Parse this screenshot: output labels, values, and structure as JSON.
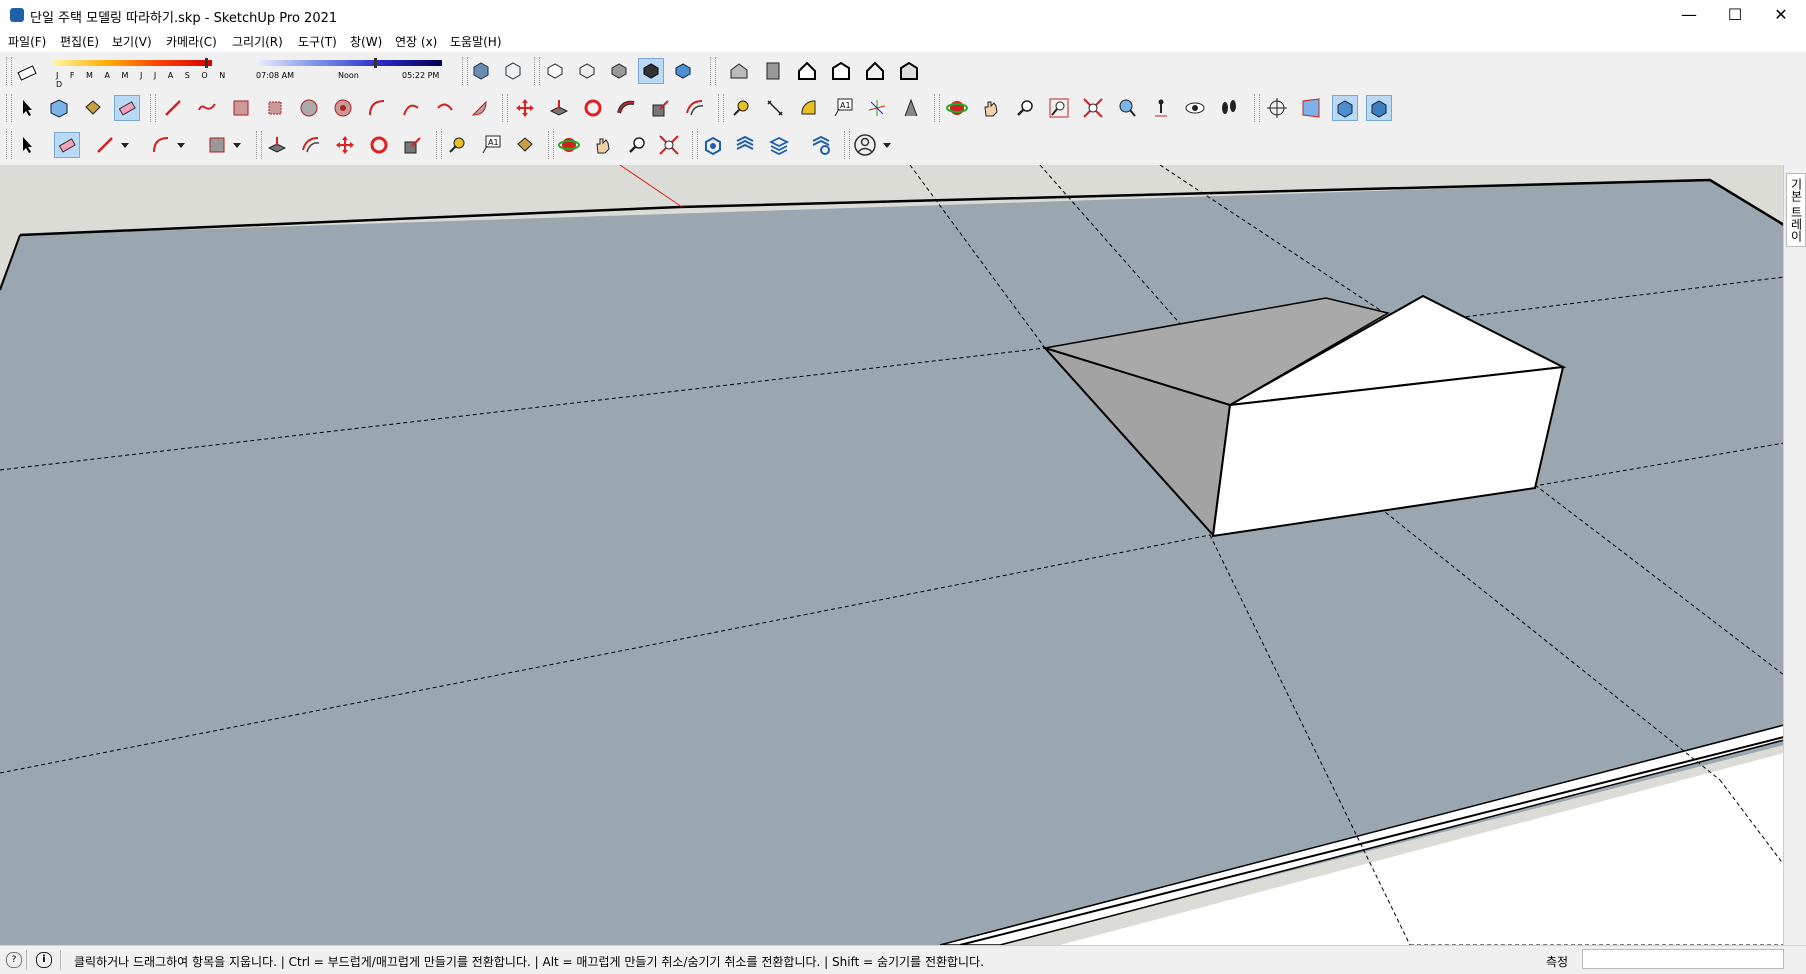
{
  "window": {
    "title": "단일 주택 모델링 따라하기.skp - SketchUp Pro 2021",
    "minimize": "—",
    "maximize": "☐",
    "close": "✕"
  },
  "menu": [
    "파일(F)",
    "편집(E)",
    "보기(V)",
    "카메라(C)",
    "그리기(R)",
    "도구(T)",
    "창(W)",
    "연장 (x)",
    "도움말(H)"
  ],
  "shadows": {
    "months": "J F M A M J J A S O N D",
    "time_start": "07:08 AM",
    "time_mid": "Noon",
    "time_end": "05:22 PM",
    "month_position": 0.97,
    "time_position": 0.63
  },
  "tray": {
    "label": "기본 트레이"
  },
  "status": {
    "message": "클릭하거나 드래그하여 항목을 지웁니다. | Ctrl = 부드럽게/매끄럽게 만들기를 전환합니다. | Alt = 매끄럽게 만들기 취소/숨기기 취소를 전환합니다. | Shift = 숨기기를 전환합니다.",
    "measure_label": "측정",
    "measure_value": ""
  },
  "colors": {
    "ground": "#9aa6b0",
    "active_tool": "#b9d9f5",
    "accent": "#1f5fa8"
  }
}
